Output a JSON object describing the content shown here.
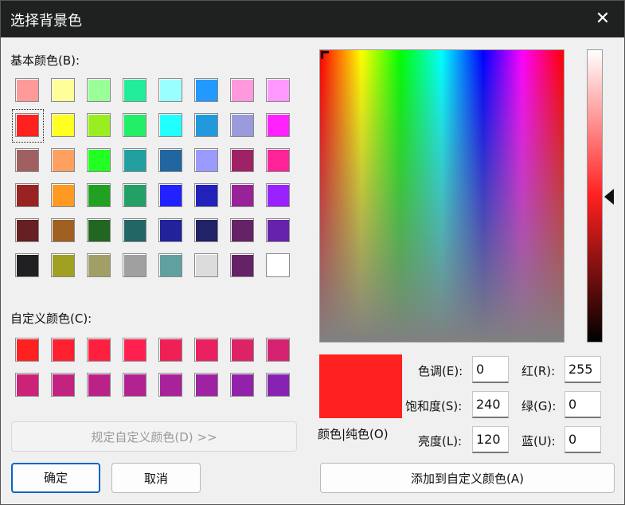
{
  "window": {
    "title": "选择背景色",
    "close_glyph": "✕"
  },
  "basic": {
    "label": "基本颜色(B):",
    "colors": [
      [
        "#ff9a9a",
        "#ffff99",
        "#99ff99",
        "#22ee99",
        "#99ffff",
        "#2299ff",
        "#ff99dd",
        "#ff99ff"
      ],
      [
        "#ff2020",
        "#ffff22",
        "#99ee22",
        "#22ee66",
        "#22ffff",
        "#2299dd",
        "#9a9add",
        "#ff22ff"
      ],
      [
        "#a06060",
        "#ffa060",
        "#22ff22",
        "#22a0a0",
        "#2266a0",
        "#9a9aff",
        "#a02266",
        "#ff2299"
      ],
      [
        "#992222",
        "#ff9922",
        "#22a022",
        "#22a066",
        "#2222ff",
        "#2222bb",
        "#992299",
        "#9922ff"
      ],
      [
        "#661f22",
        "#a06022",
        "#226622",
        "#226666",
        "#22229a",
        "#222266",
        "#662266",
        "#6622aa"
      ],
      [
        "#202022",
        "#a0a022",
        "#a0a066",
        "#a0a0a0",
        "#60a0a0",
        "#dcdcdc",
        "#662266",
        "#ffffff"
      ]
    ]
  },
  "custom": {
    "label": "自定义颜色(C):",
    "colors": [
      [
        "#ff2020",
        "#ff2030",
        "#ff2040",
        "#ff2050",
        "#ee2055",
        "#ea2060",
        "#dd2266",
        "#d42270"
      ],
      [
        "#cc2277",
        "#c22280",
        "#bb2288",
        "#b22290",
        "#a8229a",
        "#9e22a2",
        "#9222aa",
        "#8822b2"
      ]
    ]
  },
  "define_custom_button": "规定自定义颜色(D) >>",
  "ok_button": "确定",
  "cancel_button": "取消",
  "add_custom_button": "添加到自定义颜色(A)",
  "preview_label": "颜色|纯色(O)",
  "fields": {
    "hue": {
      "label": "色调(E):",
      "value": "0"
    },
    "sat": {
      "label": "饱和度(S):",
      "value": "240"
    },
    "lum": {
      "label": "亮度(L):",
      "value": "120"
    },
    "red": {
      "label": "红(R):",
      "value": "255"
    },
    "green": {
      "label": "绿(G):",
      "value": "0"
    },
    "blue": {
      "label": "蓝(U):",
      "value": "0"
    }
  },
  "current_color": "#ff2020"
}
